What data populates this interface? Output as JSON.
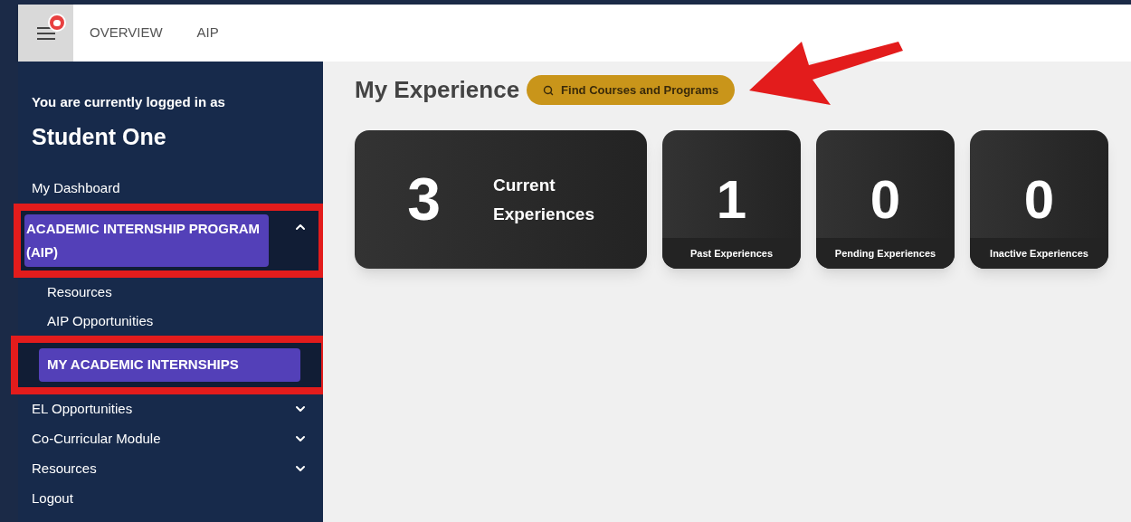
{
  "top_nav": {
    "tabs": [
      {
        "label": "OVERVIEW",
        "selected": false
      },
      {
        "label": "AIP",
        "selected": false
      }
    ],
    "menu_notification": true
  },
  "sidebar": {
    "logged_in_label": "You are currently logged in as",
    "user_name": "Student One",
    "items": [
      {
        "label": "My Dashboard",
        "kind": "link",
        "selected": false,
        "annotated": false
      },
      {
        "label": "ACADEMIC INTERNSHIP PROGRAM (AIP)",
        "kind": "group",
        "expanded": true,
        "selected": true,
        "annotated": true,
        "children": [
          {
            "label": "Resources",
            "selected": false,
            "annotated": false
          },
          {
            "label": "AIP Opportunities",
            "selected": false,
            "annotated": false
          },
          {
            "label": "MY ACADEMIC INTERNSHIPS",
            "selected": true,
            "annotated": true
          }
        ]
      },
      {
        "label": "EL Opportunities",
        "kind": "group",
        "expanded": false,
        "selected": false,
        "annotated": false
      },
      {
        "label": "Co-Curricular Module",
        "kind": "group",
        "expanded": false,
        "selected": false,
        "annotated": false
      },
      {
        "label": "Resources",
        "kind": "group",
        "expanded": false,
        "selected": false,
        "annotated": false
      },
      {
        "label": "Logout",
        "kind": "link",
        "selected": false,
        "annotated": false
      }
    ]
  },
  "main": {
    "heading": "My Experience",
    "find_button": "Find Courses and Programs",
    "button_annotated": true,
    "cards": [
      {
        "kind": "wide",
        "count": "3",
        "caption": "Current Experiences"
      },
      {
        "kind": "small",
        "count": "1",
        "caption": "Past Experiences"
      },
      {
        "kind": "small",
        "count": "0",
        "caption": "Pending Experiences"
      },
      {
        "kind": "small",
        "count": "0",
        "caption": "Inactive Experiences"
      }
    ]
  }
}
